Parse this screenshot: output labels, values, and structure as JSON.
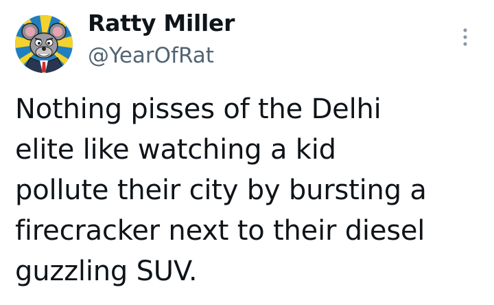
{
  "author": {
    "display_name": "Ratty Miller",
    "handle": "@YearOfRat",
    "avatar_icon": "cartoon-rat-avatar"
  },
  "menu": {
    "icon": "more-options-icon"
  },
  "tweet": {
    "lines": [
      "Nothing pisses of the Delhi",
      "elite like watching a kid",
      "pollute their city by bursting a",
      "firecracker next to their diesel",
      "guzzling SUV."
    ]
  },
  "colors": {
    "text": "#0f1419",
    "secondary_text": "#536471",
    "background": "#ffffff"
  }
}
